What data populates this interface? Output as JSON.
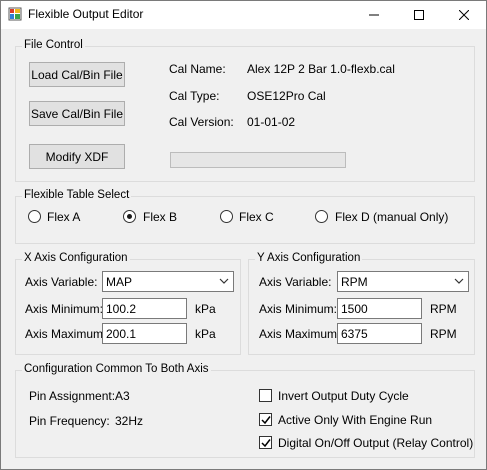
{
  "window": {
    "title": "Flexible Output Editor"
  },
  "file_control": {
    "group_title": "File Control",
    "load_button": "Load Cal/Bin File",
    "save_button": "Save Cal/Bin File",
    "modify_button": "Modify XDF",
    "cal_name_label": "Cal Name:",
    "cal_name_value": "Alex 12P 2 Bar 1.0-flexb.cal",
    "cal_type_label": "Cal Type:",
    "cal_type_value": "OSE12Pro Cal",
    "cal_version_label": "Cal Version:",
    "cal_version_value": "01-01-02",
    "progress": 0
  },
  "flex_table": {
    "group_title": "Flexible Table Select",
    "options": [
      {
        "label": "Flex A",
        "checked": false
      },
      {
        "label": "Flex B",
        "checked": true
      },
      {
        "label": "Flex C",
        "checked": false
      },
      {
        "label": "Flex D (manual Only)",
        "checked": false
      }
    ]
  },
  "x_axis": {
    "group_title": "X Axis Configuration",
    "variable_label": "Axis Variable:",
    "variable_value": "MAP",
    "min_label": "Axis Minimum:",
    "min_value": "100.2",
    "min_unit": "kPa",
    "max_label": "Axis Maximum:",
    "max_value": "200.1",
    "max_unit": "kPa"
  },
  "y_axis": {
    "group_title": "Y Axis Configuration",
    "variable_label": "Axis Variable:",
    "variable_value": "RPM",
    "min_label": "Axis Minimum:",
    "min_value": "1500",
    "min_unit": "RPM",
    "max_label": "Axis Maximum:",
    "max_value": "6375",
    "max_unit": "RPM"
  },
  "common": {
    "group_title": "Configuration Common To Both Axis",
    "pin_assignment_label": "Pin Assignment:",
    "pin_assignment_value": "A3",
    "pin_frequency_label": "Pin Frequency:",
    "pin_frequency_value": "32Hz",
    "checks": [
      {
        "label": "Invert Output Duty Cycle",
        "checked": false
      },
      {
        "label": "Active Only With Engine Run",
        "checked": true
      },
      {
        "label": "Digital On/Off Output (Relay Control)",
        "checked": true
      }
    ]
  }
}
